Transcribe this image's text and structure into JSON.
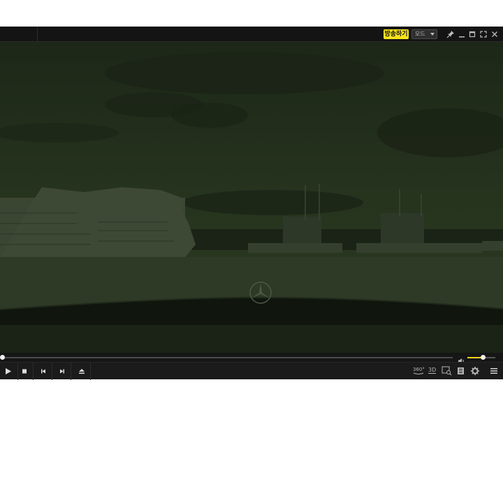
{
  "titlebar": {
    "broadcast_label": "방송하기",
    "mode_label": "모드",
    "icons": [
      "pin-icon",
      "minimize-icon",
      "maximize-icon",
      "fullscreen-icon",
      "close-icon"
    ]
  },
  "playback": {
    "seek_progress": 0.0,
    "volume_level": 0.55
  },
  "controls": {
    "left": [
      "play-icon",
      "stop-icon",
      "previous-icon",
      "next-icon",
      "eject-icon"
    ],
    "right_labels": {
      "vr": "360°",
      "three_d": "3D"
    },
    "right": [
      "vr-360-icon",
      "3d-icon",
      "zoom-icon",
      "chapter-icon",
      "settings-icon",
      "menu-icon"
    ]
  },
  "colors": {
    "accent": "#f7e21b",
    "video_tint": "#1f2b18"
  }
}
